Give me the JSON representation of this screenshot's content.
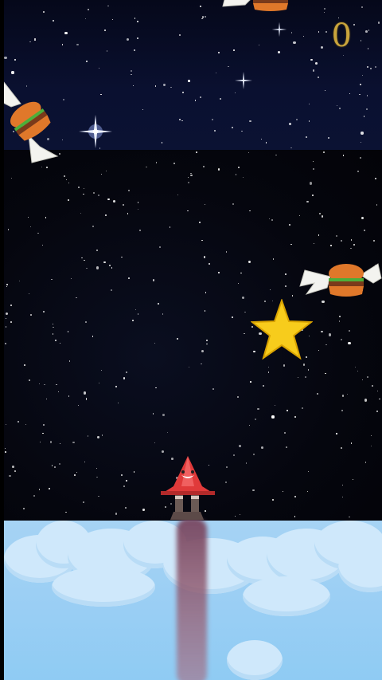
{
  "hud": {
    "score": "0"
  },
  "colors": {
    "score": "#c9a43c",
    "rocket": "#e03a3a",
    "star": "#f7cc1c",
    "sky": "#a6d3f4",
    "cloud": "#cfe8fb"
  },
  "sprites": {
    "player": "red-rocket",
    "collectible": "gold-star",
    "enemy": "winged-burger"
  }
}
